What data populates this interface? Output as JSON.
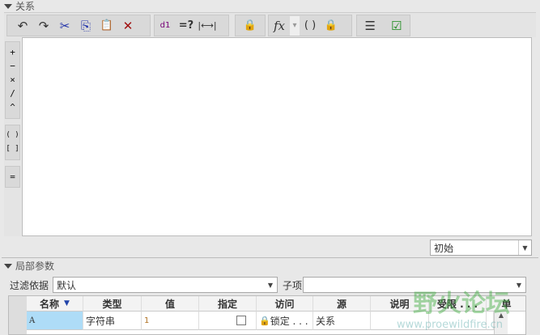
{
  "relations": {
    "title": "关系",
    "toolbar": [
      {
        "icon": "undo-icon",
        "glyph": "↶"
      },
      {
        "icon": "redo-icon",
        "glyph": "↷"
      },
      {
        "icon": "cut-icon",
        "glyph": "✂"
      },
      {
        "icon": "copy-icon",
        "glyph": "⎘"
      },
      {
        "icon": "paste-icon",
        "glyph": "📋"
      },
      {
        "icon": "delete-icon",
        "glyph": "✕"
      },
      {
        "icon": "sort-relations-icon",
        "glyph": "d1"
      },
      {
        "icon": "evaluate-icon",
        "glyph": "=?"
      },
      {
        "icon": "dimension-icon",
        "glyph": "|⟷|"
      },
      {
        "icon": "verify-lock-icon",
        "glyph": "🔒"
      },
      {
        "icon": "function-icon",
        "glyph": "fx"
      },
      {
        "icon": "dropdown-icon",
        "glyph": "▾"
      },
      {
        "icon": "brackets-icon",
        "glyph": "( )"
      },
      {
        "icon": "parameter-lock-icon",
        "glyph": "🔒"
      },
      {
        "icon": "list-icon",
        "glyph": "☰"
      },
      {
        "icon": "verify-icon",
        "glyph": "☑"
      }
    ],
    "operators": [
      "+",
      "−",
      "×",
      "/",
      "^",
      "( )",
      "[ ]",
      "="
    ],
    "mode_select": "初始"
  },
  "local_params": {
    "title": "局部参数",
    "filter_label": "过滤依据",
    "filter_value": "默认",
    "sub_label": "子项",
    "sub_value": "",
    "columns": [
      "名称",
      "类型",
      "值",
      "指定",
      "访问",
      "源",
      "说明",
      "受限 . . .",
      "单"
    ],
    "rows": [
      {
        "name": "A",
        "type": "字符串",
        "value": "1",
        "designated": false,
        "access": "锁定 . . .",
        "source": "关系",
        "desc": "",
        "restricted": "",
        "unit": ""
      }
    ]
  },
  "watermark": {
    "text": "野火论坛",
    "url": "www.proewildfire.cn"
  }
}
